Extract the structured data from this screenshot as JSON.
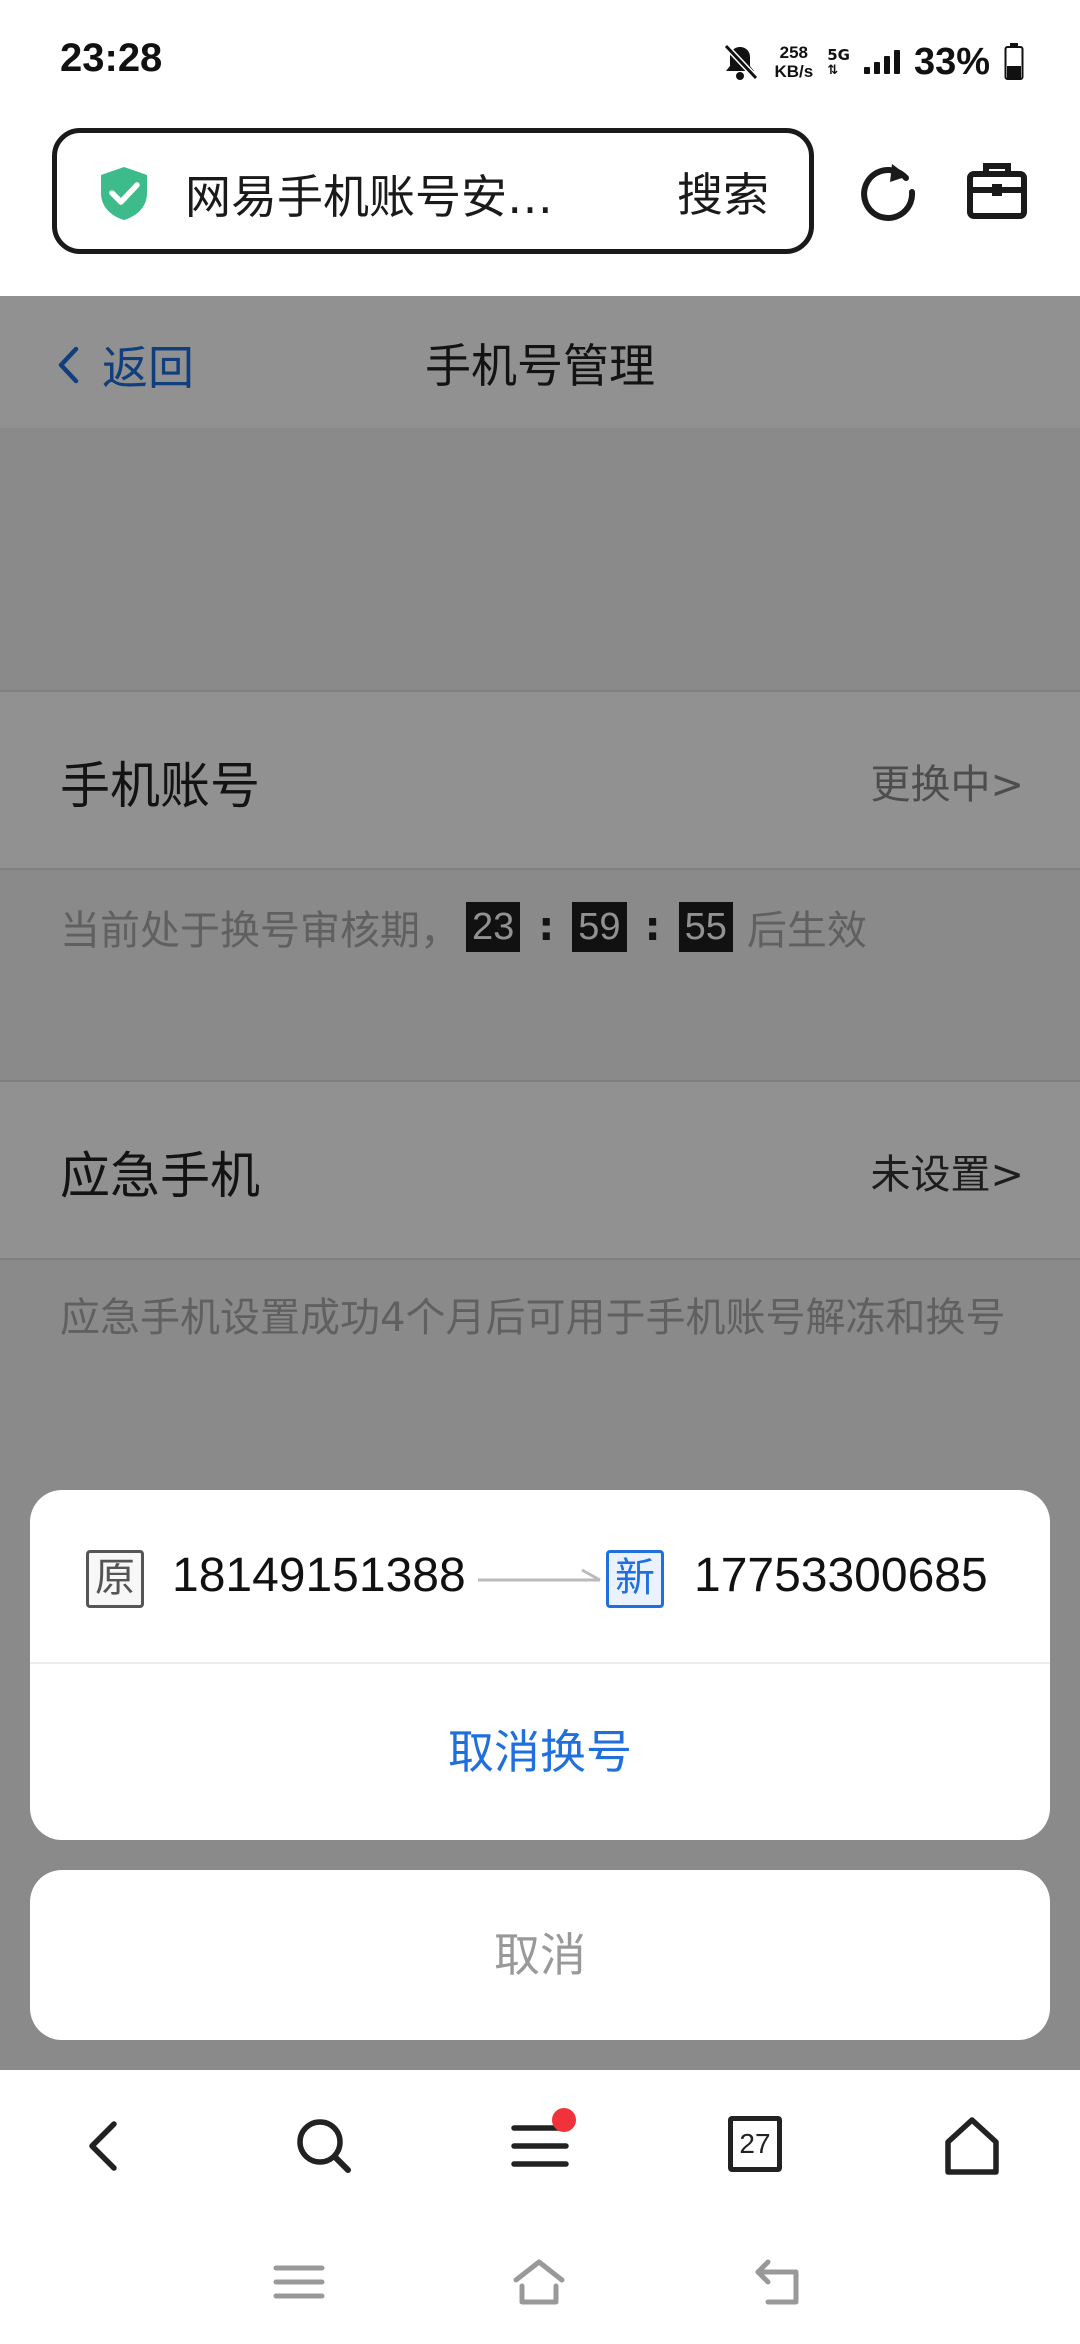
{
  "status_bar": {
    "time": "23:28",
    "speed_value": "258",
    "speed_unit": "KB/s",
    "network": "5G",
    "battery": "33%"
  },
  "browser": {
    "url_title": "网易手机账号安…",
    "search_label": "搜索",
    "accent_color": "#3dbb8a"
  },
  "page": {
    "back_label": "返回",
    "title": "手机号管理",
    "phone_account": {
      "label": "手机账号",
      "status": "更换中>"
    },
    "review_notice": {
      "prefix": "当前处于换号审核期，",
      "hours": "23",
      "minutes": "59",
      "seconds": "55",
      "colon": ":",
      "suffix": "后生效"
    },
    "emergency_phone": {
      "label": "应急手机",
      "status": "未设置>"
    },
    "emergency_note": "应急手机设置成功4个月后可用于手机账号解冻和换号"
  },
  "action_sheet": {
    "old_tag": "原",
    "old_number": "18149151388",
    "new_tag": "新",
    "new_number": "17753300685",
    "cancel_change_label": "取消换号",
    "cancel_label": "取消"
  },
  "bottom_toolbar": {
    "tab_count": "27"
  },
  "colors": {
    "link_blue": "#1f6fdc",
    "badge_red": "#f0333a"
  }
}
